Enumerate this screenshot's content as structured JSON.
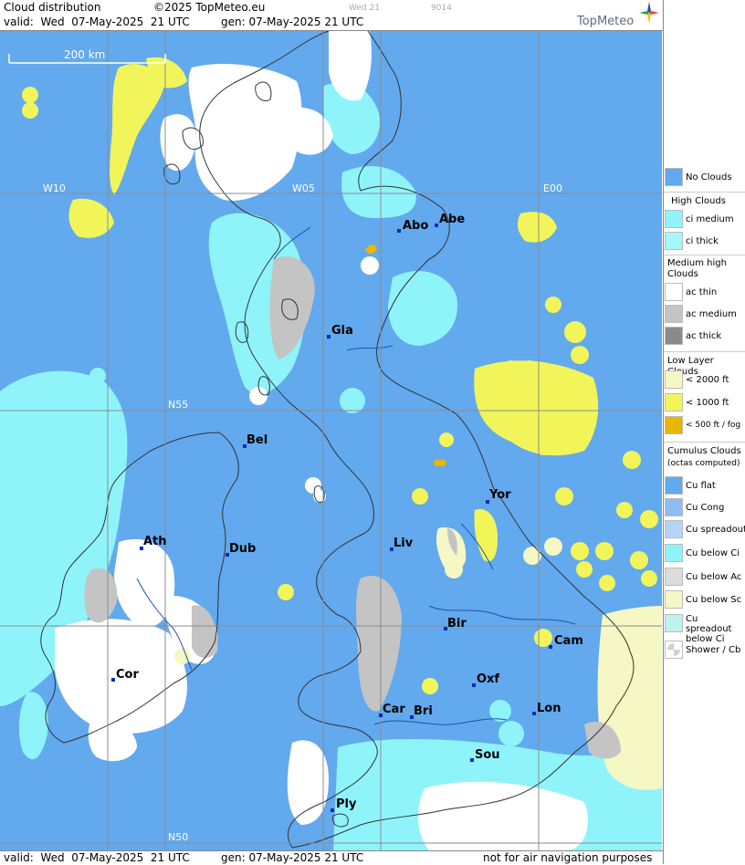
{
  "header": {
    "title": "Cloud distribution",
    "copyright": "©2025 TopMeteo.eu",
    "day_code": "Wed 21",
    "run_code": "9014",
    "valid": "valid:  Wed  07-May-2025  21 UTC",
    "gen": "gen: 07-May-2025 21 UTC",
    "logo": "TopMeteo"
  },
  "footer": {
    "valid": "valid:  Wed  07-May-2025  21 UTC",
    "gen": "gen: 07-May-2025 21 UTC",
    "disclaimer": "not for air navigation purposes"
  },
  "map": {
    "scale_label": "200 km",
    "grid_labels": [
      "W10",
      "W05",
      "E00",
      "N55",
      "N50"
    ],
    "cities": [
      {
        "name": "Abo"
      },
      {
        "name": "Abe"
      },
      {
        "name": "Gla"
      },
      {
        "name": "Bel"
      },
      {
        "name": "Yor"
      },
      {
        "name": "Ath"
      },
      {
        "name": "Dub"
      },
      {
        "name": "Liv"
      },
      {
        "name": "Bir"
      },
      {
        "name": "Cam"
      },
      {
        "name": "Cor"
      },
      {
        "name": "Oxf"
      },
      {
        "name": "Car"
      },
      {
        "name": "Bri"
      },
      {
        "name": "Lon"
      },
      {
        "name": "Sou"
      },
      {
        "name": "Ply"
      }
    ],
    "colors": {
      "no_clouds": "#62a9ee",
      "ci_medium": "#8ef4fa",
      "high_white": "#ffffff",
      "low_yellow": "#f2f55a",
      "low_pale": "#f5f8c4",
      "fog": "#e9b600",
      "ac_medium": "#c4c4c4",
      "coast": "#333333",
      "river": "#1f4fb5",
      "grid": "#8d8d8d",
      "city": "#0a2bb8"
    }
  },
  "legend": {
    "no_clouds": "No Clouds",
    "high_title": "High Clouds",
    "ci_medium": "ci medium",
    "ci_thick": "ci thick",
    "medium_title": "Medium high Clouds",
    "ac_thin": "ac thin",
    "ac_medium": "ac medium",
    "ac_thick": "ac thick",
    "low_title": "Low Layer Clouds",
    "lt2000": "< 2000 ft",
    "lt1000": "< 1000 ft",
    "lt500": "< 500 ft / fog",
    "cumulus_title": "Cumulus Clouds",
    "cumulus_sub": "(octas computed)",
    "cu_flat": "Cu flat",
    "cu_cong": "Cu Cong",
    "cu_spreadout": "Cu spreadout",
    "cu_below_ci": "Cu below Ci",
    "cu_below_ac": "Cu below Ac",
    "cu_below_sc": "Cu below Sc",
    "cu_spreadout_below_ci": "Cu spreadout below Ci",
    "shower": "Shower / Cb"
  }
}
